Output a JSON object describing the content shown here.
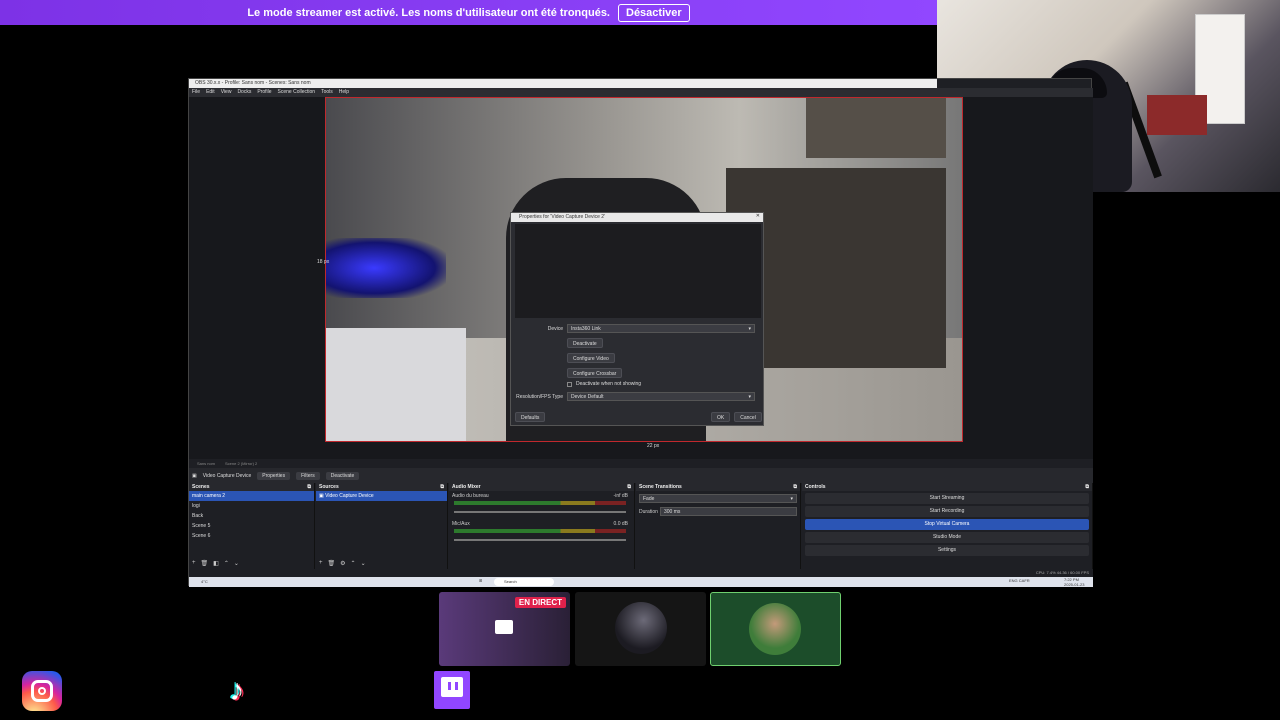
{
  "banner": {
    "text": "Le mode streamer est activé. Les noms d'utilisateur ont été tronqués.",
    "button": "Désactiver"
  },
  "obs": {
    "title": "OBS 30.x.x - Profile: Sans nom - Scenes: Sans nom",
    "menu": [
      "File",
      "Edit",
      "View",
      "Docks",
      "Profile",
      "Scene Collection",
      "Tools",
      "Help"
    ],
    "preview_labels": {
      "left": "18 px",
      "bottom": "22 px"
    },
    "dialog": {
      "title": "Properties for 'Video Capture Device 2'",
      "device_label": "Device",
      "device_value": "Insta360 Link",
      "buttons": [
        "Deactivate",
        "Configure Video",
        "Configure Crossbar"
      ],
      "checkbox": "Deactivate when not showing",
      "resolution_label": "Resolution/FPS Type",
      "resolution_value": "Device Default",
      "defaults": "Defaults",
      "ok": "OK",
      "cancel": "Cancel"
    },
    "scenebar": [
      "Sans nom",
      "Scene 2 (Mirror) 2"
    ],
    "source_toolbar": {
      "name": "Video Capture Device",
      "properties": "Properties",
      "filters": "Filters",
      "deactivate": "Deactivate"
    },
    "scenes": {
      "title": "Scenes",
      "items": [
        "main camera 2",
        "logi",
        "Back",
        "Scene 5",
        "Scene 6"
      ]
    },
    "sources": {
      "title": "Sources",
      "items": [
        "Video Capture Device"
      ]
    },
    "audio": {
      "title": "Audio Mixer",
      "channels": [
        {
          "name": "Audio du bureau",
          "db": "-inf dB"
        },
        {
          "name": "Mic/Aux",
          "db": "0.0 dB"
        }
      ]
    },
    "transitions": {
      "title": "Scene Transitions",
      "type": "Fade",
      "duration_label": "Duration",
      "duration": "300 ms"
    },
    "controls": {
      "title": "Controls",
      "buttons": [
        "Start Streaming",
        "Start Recording",
        "Stop Virtual Camera",
        "Studio Mode",
        "Settings"
      ]
    },
    "status": "CPU: 7.4%   44.36 / 60.00 FPS",
    "taskbar": {
      "weather": "4°C",
      "search": "Search",
      "lang": "ENG CAFR",
      "time": "7:22 PM",
      "date": "2025-01-23"
    }
  },
  "tiles": {
    "live_badge": "EN DIRECT"
  },
  "socials": [
    "instagram",
    "tiktok",
    "twitch"
  ],
  "colors": {
    "banner": "#9147ff",
    "preview_border": "#c0282d",
    "selection": "#2b55b5"
  }
}
